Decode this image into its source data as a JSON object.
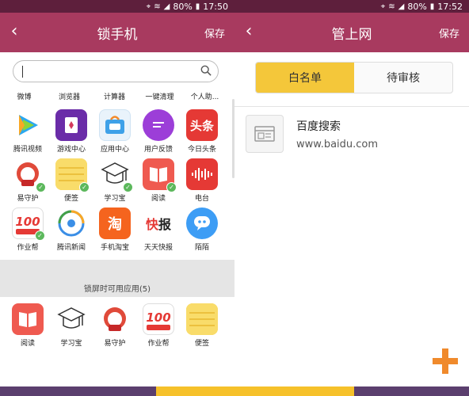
{
  "colors": {
    "appbar": "#a83a5f",
    "statusbar": "#5e1f3c",
    "accent": "#f4c73a",
    "plus": "#f08a2c",
    "bottom_left": "#5b3f6e",
    "bottom_mid": "#f6c12a",
    "bottom_right": "#5b3f6e"
  },
  "left": {
    "status": {
      "battery": "80%",
      "time": "17:50"
    },
    "title": "锁手机",
    "save": "保存",
    "back_icon": "chevron-left-icon",
    "search": {
      "value": "",
      "placeholder": ""
    },
    "header_labels": [
      "微博",
      "浏览器",
      "计算器",
      "一键清理",
      "个人助..."
    ],
    "apps": [
      {
        "label": "腾讯视频",
        "icon": "tencent-video-icon",
        "checked": false
      },
      {
        "label": "游戏中心",
        "icon": "game-center-icon",
        "checked": false
      },
      {
        "label": "应用中心",
        "icon": "app-center-icon",
        "checked": false
      },
      {
        "label": "用户反馈",
        "icon": "feedback-icon",
        "checked": false
      },
      {
        "label": "今日头条",
        "icon": "toutiao-icon",
        "checked": false
      },
      {
        "label": "易守护",
        "icon": "yishouhu-icon",
        "checked": true
      },
      {
        "label": "便签",
        "icon": "notes-icon",
        "checked": true
      },
      {
        "label": "学习宝",
        "icon": "xuexibao-icon",
        "checked": true
      },
      {
        "label": "阅读",
        "icon": "reader-icon",
        "checked": true
      },
      {
        "label": "电台",
        "icon": "radio-icon",
        "checked": false
      },
      {
        "label": "作业帮",
        "icon": "zuoyebang-icon",
        "checked": true
      },
      {
        "label": "腾讯新闻",
        "icon": "tencent-news-icon",
        "checked": false
      },
      {
        "label": "手机淘宝",
        "icon": "taobao-icon",
        "checked": false
      },
      {
        "label": "天天快报",
        "icon": "kuaibao-icon",
        "checked": false
      },
      {
        "label": "陌陌",
        "icon": "momo-icon",
        "checked": false
      }
    ],
    "locked_section_label": "锁屏时可用应用(5)",
    "locked_apps": [
      {
        "label": "阅读",
        "icon": "reader-icon"
      },
      {
        "label": "学习宝",
        "icon": "xuexibao-icon"
      },
      {
        "label": "易守护",
        "icon": "yishouhu-icon"
      },
      {
        "label": "作业帮",
        "icon": "zuoyebang-icon"
      },
      {
        "label": "便签",
        "icon": "notes-icon"
      }
    ]
  },
  "right": {
    "status": {
      "battery": "80%",
      "time": "17:52"
    },
    "title": "管上网",
    "save": "保存",
    "back_icon": "chevron-left-icon",
    "tabs": [
      {
        "label": "白名单",
        "active": true
      },
      {
        "label": "待审核",
        "active": false
      }
    ],
    "sites": [
      {
        "name": "百度搜索",
        "url": "www.baidu.com",
        "icon": "browser-page-icon"
      }
    ],
    "add_icon": "plus-icon"
  }
}
